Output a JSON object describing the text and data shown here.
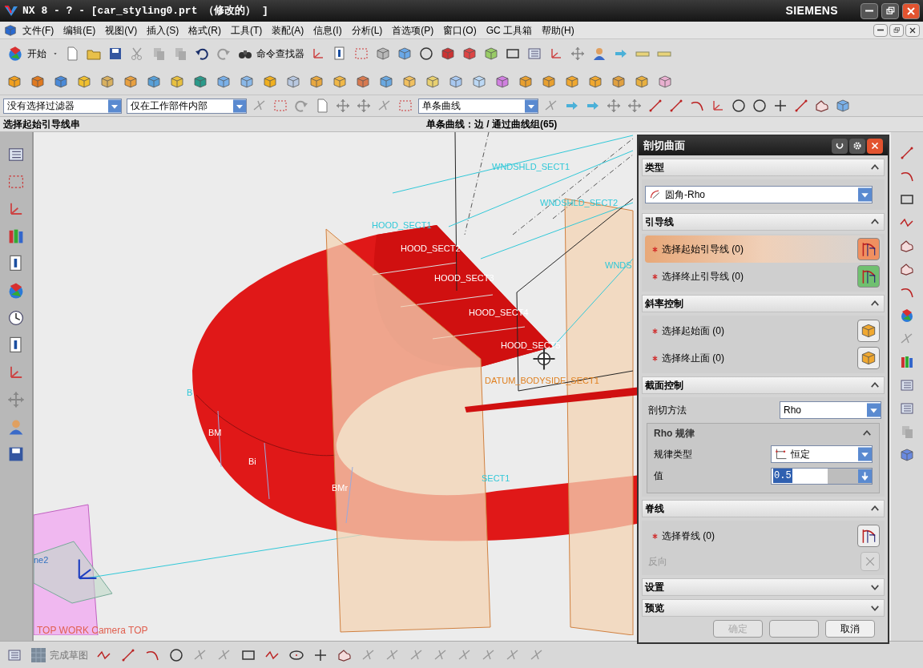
{
  "window": {
    "title": "NX 8 - ? - [car_styling0.prt （修改的） ]",
    "brand": "SIEMENS"
  },
  "menu": [
    "文件(F)",
    "编辑(E)",
    "视图(V)",
    "插入(S)",
    "格式(R)",
    "工具(T)",
    "装配(A)",
    "信息(I)",
    "分析(L)",
    "首选项(P)",
    "窗口(O)",
    "GC 工具箱",
    "帮助(H)"
  ],
  "toolbar": {
    "start": "开始",
    "command_finder": "命令查找器"
  },
  "filters": [
    {
      "value": "没有选择过滤器"
    },
    {
      "value": "仅在工作部件内部"
    },
    {
      "value": "单条曲线"
    }
  ],
  "cue_line": {
    "prompt": "选择起始引导线串",
    "status": "单条曲线：边 / 通过曲线组(65)"
  },
  "viewport": {
    "labels": [
      "WNDSHLD_SECT1",
      "WNDSHLD_SECT2",
      "WNDS",
      "HOOD_SECT1",
      "HOOD_SECT2",
      "HOOD_SECT3",
      "HOOD_SECT4",
      "HOOD_SECT5",
      "DATUM_BODYSIDE_SECT1",
      "SECT1",
      "B",
      "BM",
      "Bi",
      "BMr",
      "ne2"
    ],
    "view_name": "TOP WORK Camera TOP"
  },
  "dialog": {
    "title": "剖切曲面",
    "sections": [
      {
        "title": "类型",
        "expanded": true,
        "rows": [
          {
            "kind": "dropdown",
            "value": "圆角-Rho"
          }
        ]
      },
      {
        "title": "引导线",
        "expanded": true,
        "rows": [
          {
            "kind": "select",
            "label": "选择起始引导线 (0)",
            "selected": true
          },
          {
            "kind": "select",
            "label": "选择终止引导线 (0)",
            "selected": false
          }
        ]
      },
      {
        "title": "斜率控制",
        "expanded": true,
        "rows": [
          {
            "kind": "select_face",
            "label": "选择起始面 (0)",
            "selected": false
          },
          {
            "kind": "select_face",
            "label": "选择终止面 (0)",
            "selected": false
          }
        ]
      },
      {
        "title": "截面控制",
        "expanded": true,
        "rows": [
          {
            "kind": "field",
            "label": "剖切方法",
            "value": "Rho"
          },
          {
            "kind": "group",
            "title": "Rho 规律",
            "expanded": true,
            "rows": [
              {
                "kind": "law",
                "label": "规律类型",
                "value": "恒定"
              },
              {
                "kind": "number",
                "label": "值",
                "value": "0.5"
              }
            ]
          }
        ]
      },
      {
        "title": "脊线",
        "expanded": true,
        "rows": [
          {
            "kind": "select",
            "label": "选择脊线 (0)",
            "selected": false
          },
          {
            "kind": "toggle",
            "label": "反向",
            "disabled": true
          }
        ]
      },
      {
        "title": "设置",
        "expanded": false
      },
      {
        "title": "预览",
        "expanded": false
      }
    ],
    "buttons": [
      {
        "label": "确定",
        "disabled": true
      },
      {
        "label": "取消",
        "disabled": false
      }
    ]
  },
  "sketch_toolbar": {
    "finish": "完成草图"
  }
}
